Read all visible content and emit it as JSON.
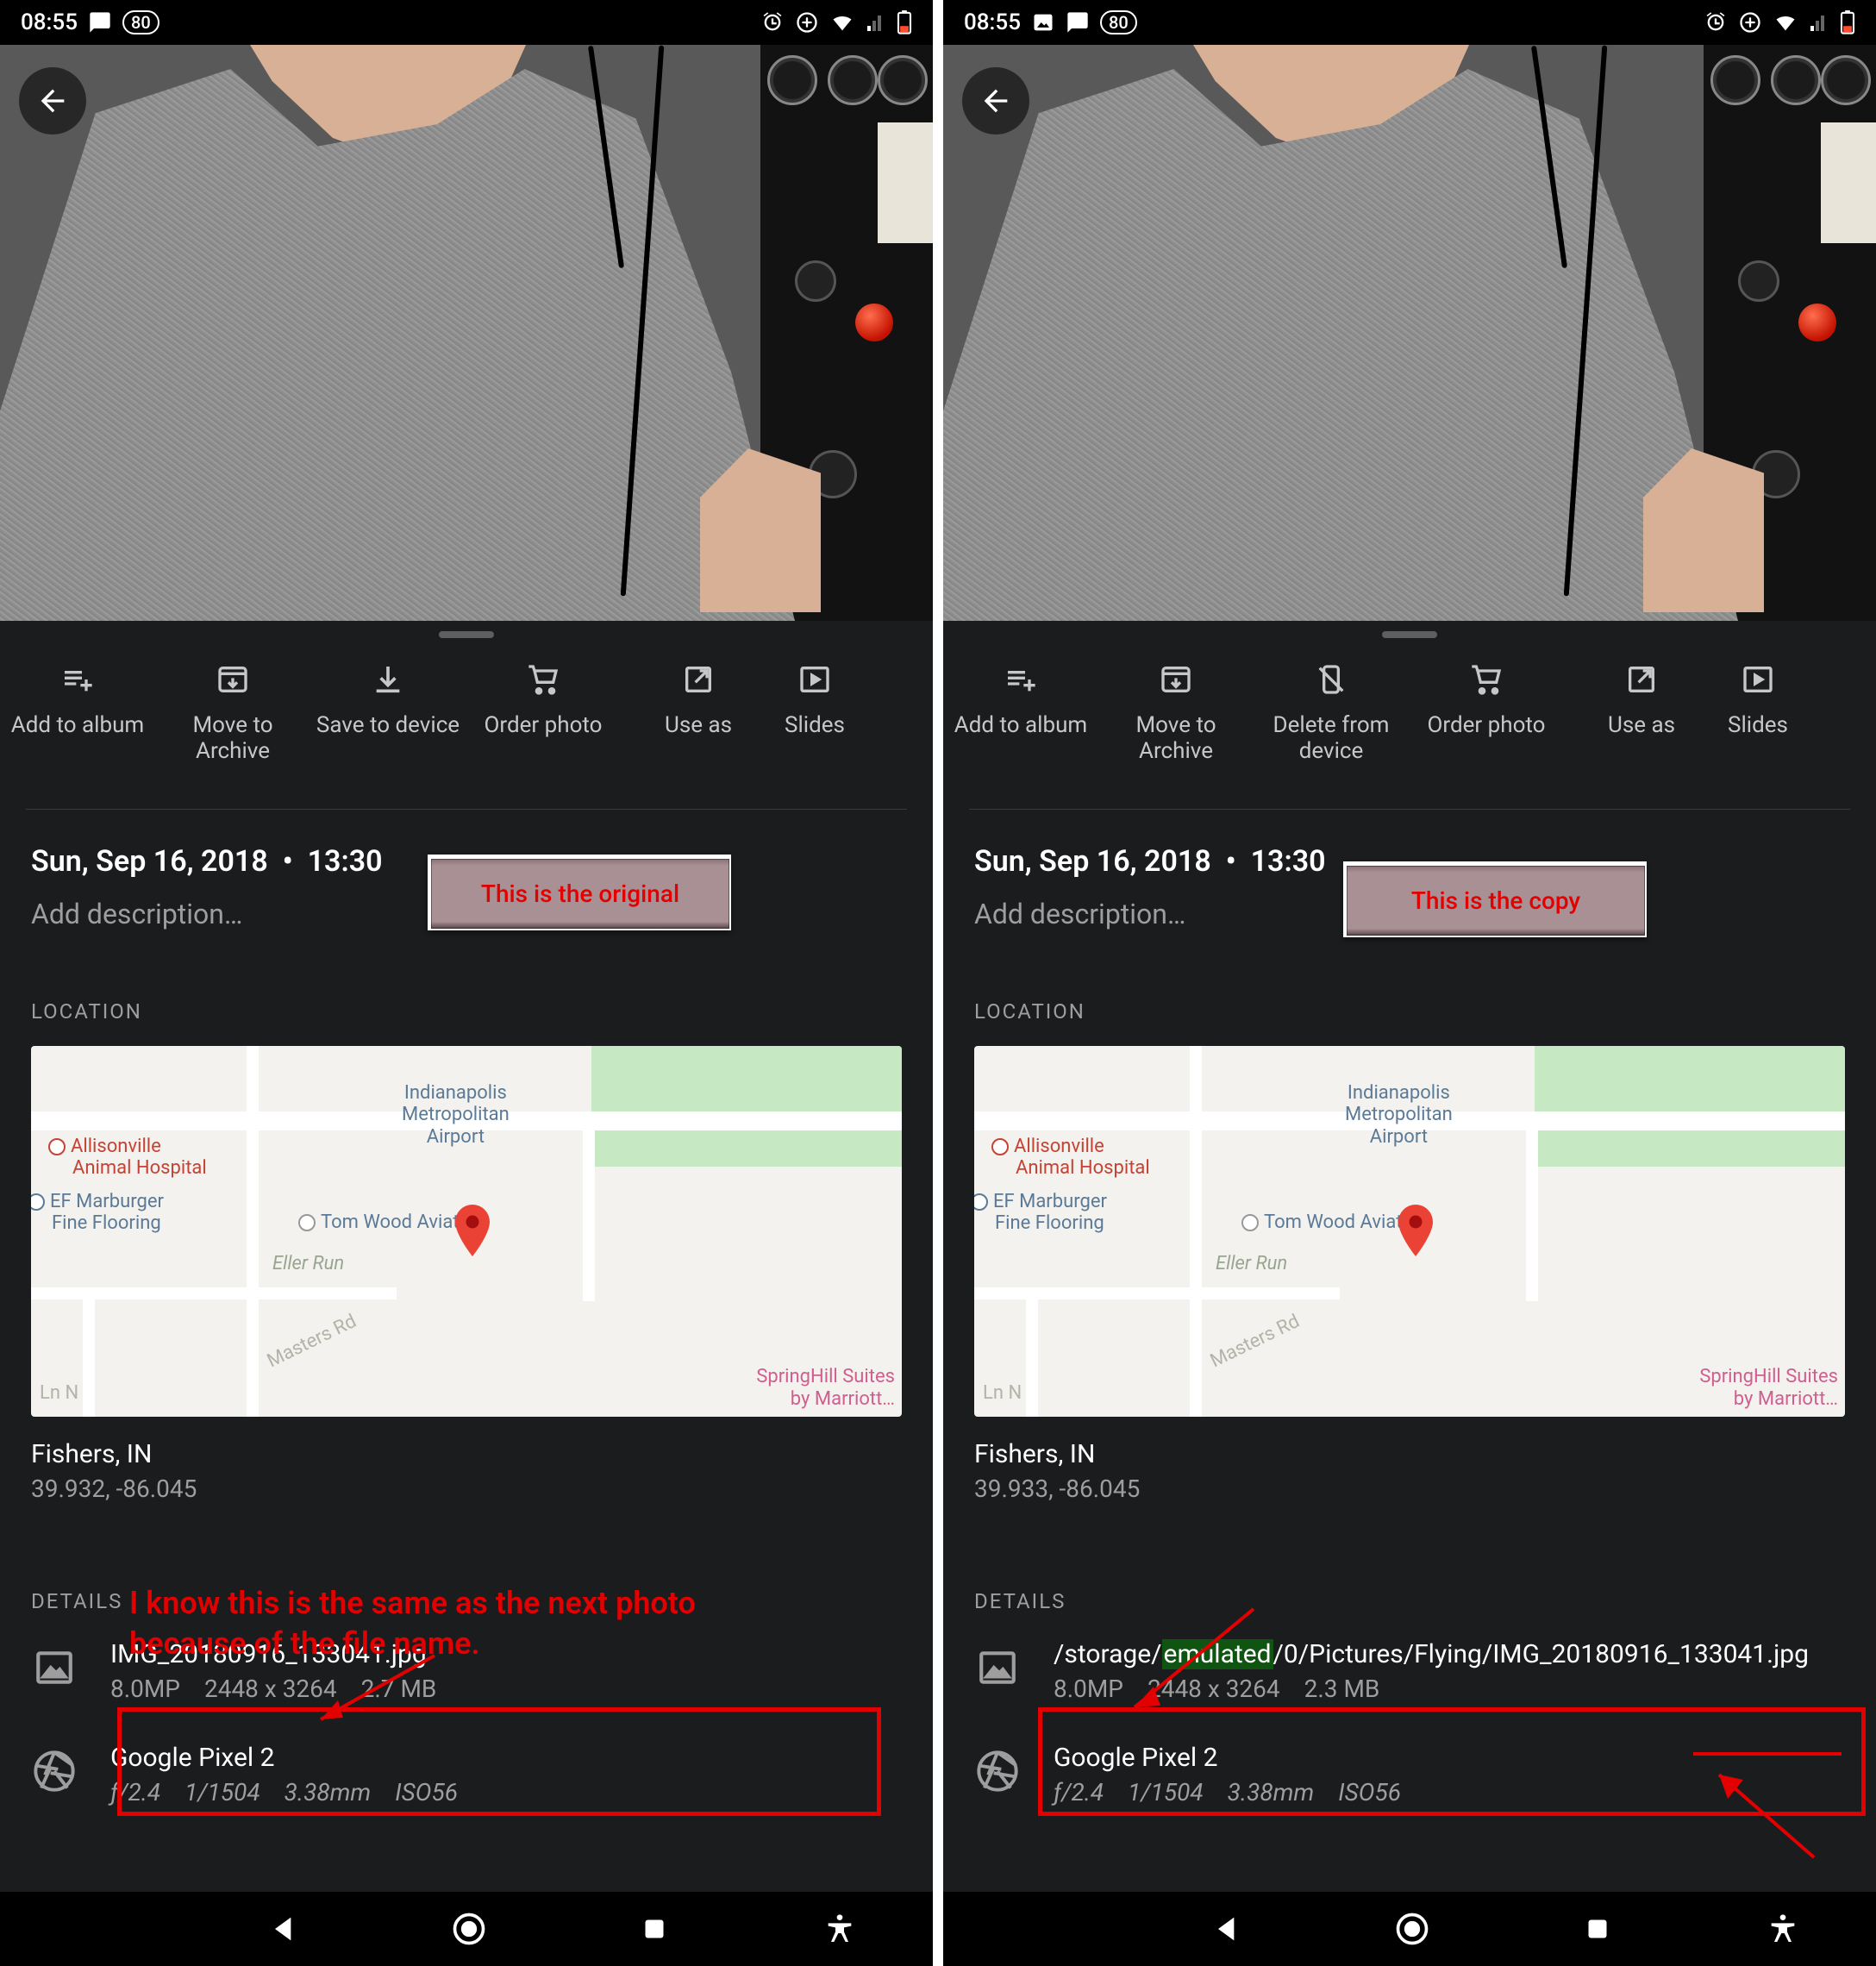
{
  "status": {
    "time": "08:55",
    "battery": "80"
  },
  "actions_left": [
    {
      "id": "add-to-album",
      "label": "Add to album"
    },
    {
      "id": "move-to-archive",
      "label": "Move to Archive"
    },
    {
      "id": "save-to-device",
      "label": "Save to device"
    },
    {
      "id": "order-photo",
      "label": "Order photo"
    },
    {
      "id": "use-as",
      "label": "Use as"
    },
    {
      "id": "slideshow",
      "label": "Slides"
    }
  ],
  "actions_right": [
    {
      "id": "add-to-album",
      "label": "Add to album"
    },
    {
      "id": "move-to-archive",
      "label": "Move to Archive"
    },
    {
      "id": "delete-from-device",
      "label": "Delete from device"
    },
    {
      "id": "order-photo",
      "label": "Order photo"
    },
    {
      "id": "use-as",
      "label": "Use as"
    },
    {
      "id": "slideshow",
      "label": "Slides"
    }
  ],
  "date": "Sun, Sep 16, 2018",
  "time_taken": "13:30",
  "desc_placeholder": "Add description…",
  "badge_left": "This is the original",
  "badge_right": "This is the copy",
  "location_header": "LOCATION",
  "map": {
    "poi_airport_l1": "Indianapolis",
    "poi_airport_l2": "Metropolitan",
    "poi_airport_l3": "Airport",
    "poi_hospital_l1": "Allisonville",
    "poi_hospital_l2": "Animal Hospital",
    "poi_floor_l1": "EF Marburger",
    "poi_floor_l2": "Fine Flooring",
    "poi_tomwood": "Tom Wood Aviati",
    "poi_eller": "Eller Run",
    "poi_masters": "Masters Rd",
    "poi_lnn": "Ln N",
    "poi_spring_l1": "SpringHill Suites",
    "poi_spring_l2": "by Marriott…"
  },
  "loc_city": "Fishers, IN",
  "loc_coords_left": "39.932, -86.045",
  "loc_coords_right": "39.933, -86.045",
  "annot_left_l1": "I know this is the same as the next photo",
  "annot_left_l2": "because of the file name.",
  "details_header": "DETAILS",
  "file_left": {
    "name": "IMG_20180916_133041.jpg",
    "mp": "8.0MP",
    "dim": "2448 x 3264",
    "size": "2.7 MB"
  },
  "file_right": {
    "path_pre": "/storage/",
    "path_em": "emulated",
    "path_post": "/0/Pictures/Flying/IMG_20180916_133041.jpg",
    "mp": "8.0MP",
    "dim": "2448 x 3264",
    "size": "2.3 MB"
  },
  "camera": {
    "name": "Google Pixel 2",
    "f": "ƒ/2.4",
    "shutter": "1/1504",
    "focal": "3.38mm",
    "iso": "ISO56"
  }
}
